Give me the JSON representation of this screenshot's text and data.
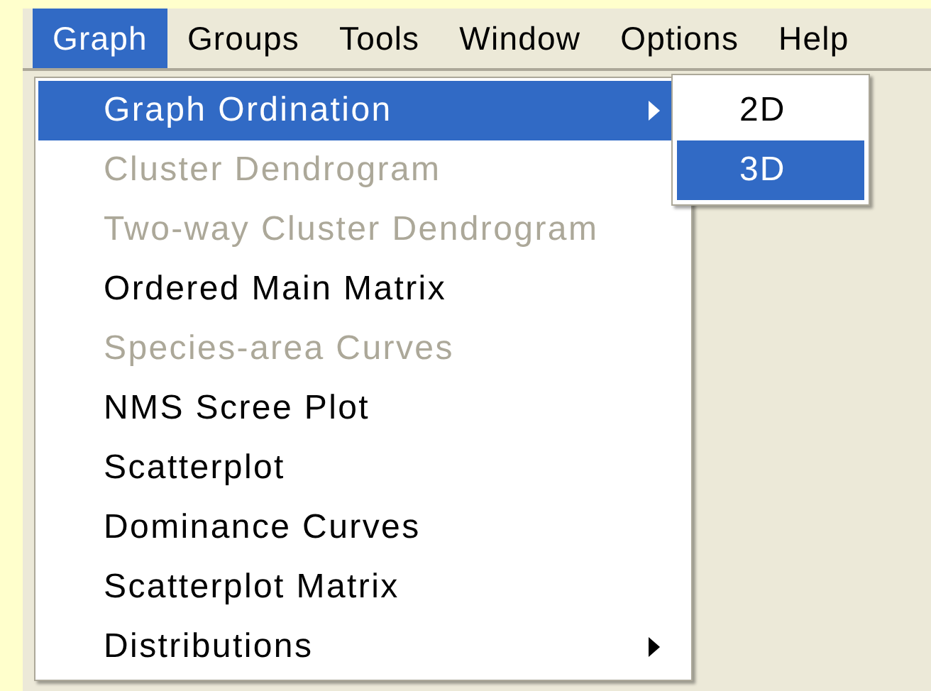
{
  "menu_bar": [
    {
      "label": "Graph",
      "selected": true
    },
    {
      "label": "Groups",
      "selected": false
    },
    {
      "label": "Tools",
      "selected": false
    },
    {
      "label": "Window",
      "selected": false
    },
    {
      "label": "Options",
      "selected": false
    },
    {
      "label": "Help",
      "selected": false
    }
  ],
  "graph_menu": [
    {
      "label": "Graph Ordination",
      "selected": true,
      "disabled": false,
      "submenu": true
    },
    {
      "label": "Cluster Dendrogram",
      "selected": false,
      "disabled": true,
      "submenu": false
    },
    {
      "label": "Two-way Cluster Dendrogram",
      "selected": false,
      "disabled": true,
      "submenu": false
    },
    {
      "label": "Ordered Main Matrix",
      "selected": false,
      "disabled": false,
      "submenu": false
    },
    {
      "label": "Species-area Curves",
      "selected": false,
      "disabled": true,
      "submenu": false
    },
    {
      "label": "NMS Scree Plot",
      "selected": false,
      "disabled": false,
      "submenu": false
    },
    {
      "label": "Scatterplot",
      "selected": false,
      "disabled": false,
      "submenu": false
    },
    {
      "label": "Dominance Curves",
      "selected": false,
      "disabled": false,
      "submenu": false
    },
    {
      "label": "Scatterplot Matrix",
      "selected": false,
      "disabled": false,
      "submenu": false
    },
    {
      "label": "Distributions",
      "selected": false,
      "disabled": false,
      "submenu": true
    }
  ],
  "ordination_submenu": [
    {
      "label": "2D",
      "selected": false
    },
    {
      "label": "3D",
      "selected": true
    }
  ]
}
